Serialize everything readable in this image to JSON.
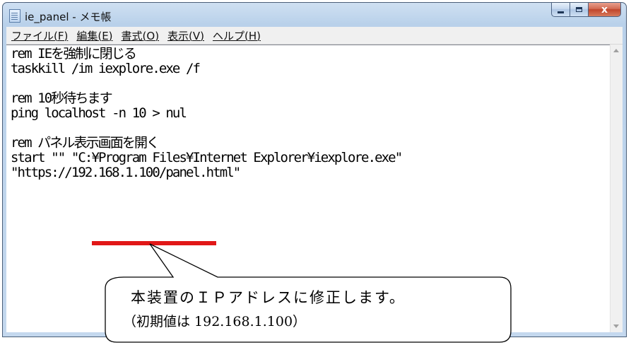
{
  "window": {
    "title": "ie_panel - メモ帳",
    "caption_close": "x"
  },
  "menu": {
    "items": [
      "ファイル(F)",
      "編集(E)",
      "書式(O)",
      "表示(V)",
      "ヘルプ(H)"
    ]
  },
  "editor": {
    "lines": [
      "rem IEを強制に閉じる",
      "taskkill /im iexplore.exe /f",
      "",
      "rem 10秒待ちます",
      "ping localhost -n 10 > nul",
      "",
      "rem パネル表示画面を開く",
      "start \"\" \"C:¥Program Files¥Internet Explorer¥iexplore.exe\"",
      "\"https://192.168.1.100/panel.html\""
    ]
  },
  "callout": {
    "line1": "本装置のＩＰアドレスに修正します。",
    "line2": "（初期値は 192.168.1.100）"
  },
  "colors": {
    "highlight": "#e11818",
    "close_button": "#c0452b"
  }
}
